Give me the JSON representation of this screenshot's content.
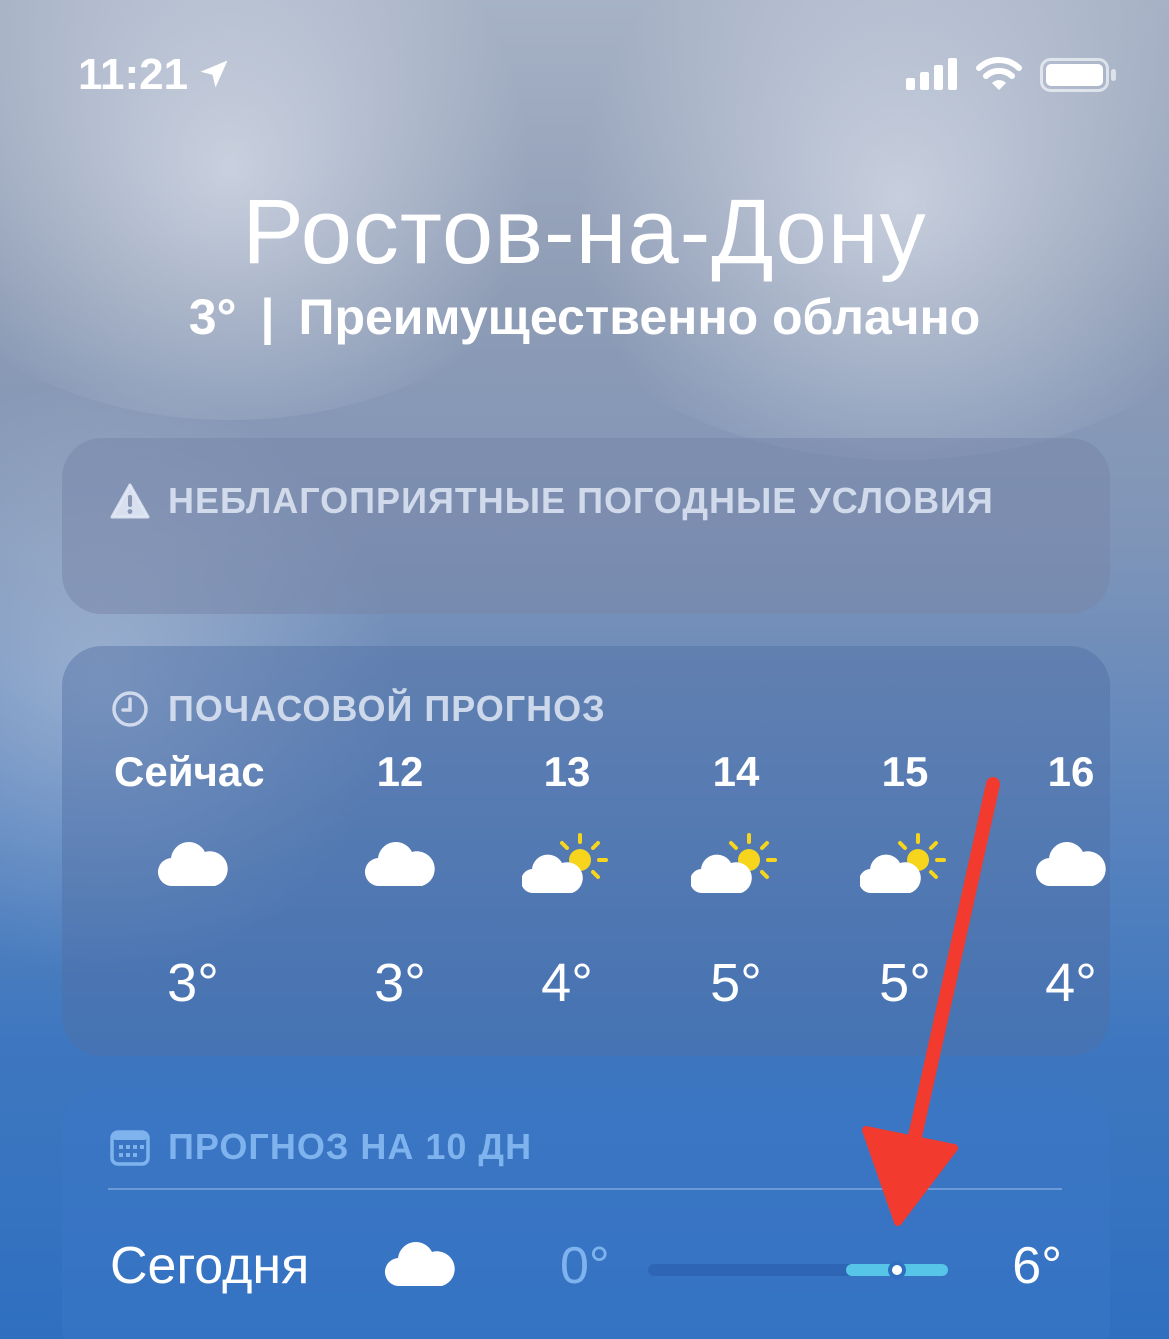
{
  "status_bar": {
    "time": "11:21",
    "icons": [
      "location-arrow-icon",
      "cellular-signal-icon",
      "wifi-icon",
      "battery-icon"
    ]
  },
  "header": {
    "city": "Ростов-на-Дону",
    "current_temp": "3°",
    "separator": "|",
    "condition": "Преимущественно облачно"
  },
  "alert": {
    "icon": "warning-triangle-icon",
    "title": "НЕБЛАГОПРИЯТНЫЕ ПОГОДНЫЕ УСЛОВИЯ"
  },
  "hourly": {
    "icon": "clock-icon",
    "title": "ПОЧАСОВОЙ ПРОГНОЗ",
    "items": [
      {
        "label": "Сейчас",
        "icon": "cloud-icon",
        "temp": "3°"
      },
      {
        "label": "12",
        "icon": "cloud-icon",
        "temp": "3°"
      },
      {
        "label": "13",
        "icon": "partly-sunny-icon",
        "temp": "4°"
      },
      {
        "label": "14",
        "icon": "partly-sunny-icon",
        "temp": "5°"
      },
      {
        "label": "15",
        "icon": "partly-sunny-icon",
        "temp": "5°"
      },
      {
        "label": "16",
        "icon": "cloud-icon",
        "temp": "4°"
      }
    ]
  },
  "daily": {
    "icon": "calendar-icon",
    "title": "ПРОГНОЗ НА 10 ДН",
    "days": [
      {
        "name": "Сегодня",
        "icon": "cloud-icon",
        "low": "0°",
        "high": "6°",
        "range_start": 0.66,
        "range_end": 1.0,
        "current_position": 0.83
      }
    ]
  },
  "colors": {
    "annotation_arrow": "#f23a2f",
    "low_temp": "#7fb3ee",
    "range_fill": "#56c5e8",
    "sun": "#f7d51c"
  }
}
